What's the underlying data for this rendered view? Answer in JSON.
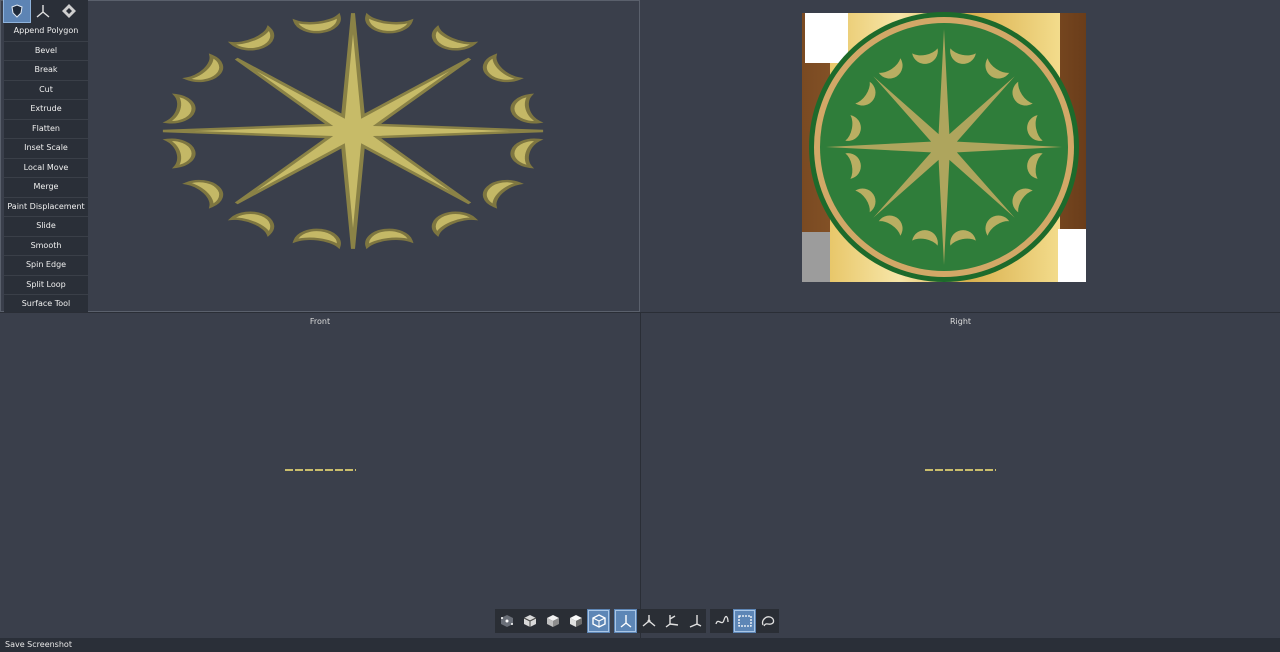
{
  "tools": {
    "mode_icons": [
      "shield-mode-icon",
      "axes-mode-icon",
      "diamond-mode-icon"
    ],
    "items": [
      "Append Polygon",
      "Bevel",
      "Break",
      "Cut",
      "Extrude",
      "Flatten",
      "Inset Scale",
      "Local Move",
      "Merge",
      "Paint Displacement",
      "Slide",
      "Smooth",
      "Spin Edge",
      "Split Loop",
      "Surface Tool"
    ]
  },
  "viewports": {
    "front_label": "Front",
    "right_label": "Right"
  },
  "toolbar": {
    "shading_icons": [
      "points-cube-icon",
      "wire-cube-icon",
      "solid-cube-icon",
      "textured-cube-icon",
      "material-cube-icon"
    ],
    "axis_icons": [
      "axis-y-up-icon",
      "axis-three-way-icon",
      "axis-tilt-icon",
      "axis-corner-icon"
    ],
    "select_icons": [
      "lasso-select-icon",
      "rect-select-icon",
      "freeform-select-icon"
    ],
    "active": [
      "material-cube-icon",
      "axis-y-up-icon",
      "rect-select-icon"
    ]
  },
  "status": {
    "text": "Save Screenshot"
  },
  "colors": {
    "gold": "#c9bd6c",
    "green": "#2f7d3a",
    "panel": "#2a2f38",
    "accent": "#5d84b4"
  }
}
